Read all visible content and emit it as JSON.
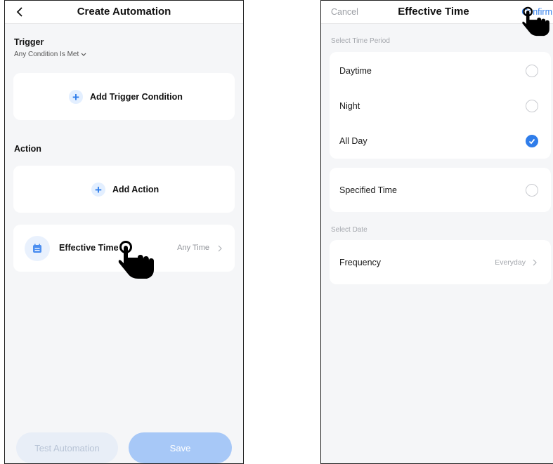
{
  "left_screen": {
    "title": "Create Automation",
    "trigger": {
      "label": "Trigger",
      "condition_selector": "Any Condition Is Met"
    },
    "add_trigger_label": "Add Trigger Condition",
    "action_label": "Action",
    "add_action_label": "Add Action",
    "effective_time": {
      "label": "Effective Time",
      "value": "Any Time"
    },
    "buttons": {
      "test": "Test Automation",
      "save": "Save"
    }
  },
  "right_screen": {
    "cancel": "Cancel",
    "title": "Effective Time",
    "confirm": "Confirm",
    "select_time_period": "Select Time Period",
    "time_options": [
      {
        "label": "Daytime",
        "selected": false
      },
      {
        "label": "Night",
        "selected": false
      },
      {
        "label": "All Day",
        "selected": true
      }
    ],
    "specified_time": {
      "label": "Specified Time",
      "selected": false
    },
    "select_date": "Select Date",
    "frequency": {
      "label": "Frequency",
      "value": "Everyday"
    }
  },
  "colors": {
    "accent": "#2f7dea",
    "background": "#f5f6f8",
    "save_disabled": "#a7c8f7",
    "test_disabled": "#e8eef7"
  }
}
